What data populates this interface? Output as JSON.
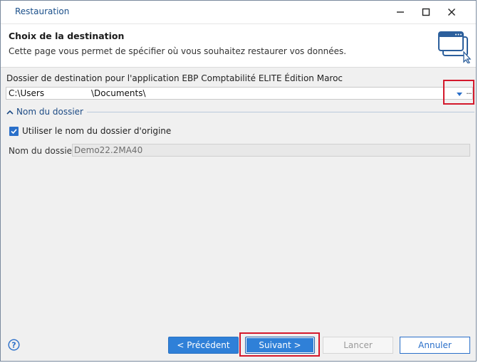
{
  "window": {
    "title": "Restauration"
  },
  "titlebar": {
    "min_symbol": "—",
    "max_symbol": "☐",
    "close_symbol": "✕"
  },
  "header": {
    "title": "Choix de la destination",
    "subtitle": "Cette page vous permet de spécifier où vous souhaitez restaurer vos données."
  },
  "destination": {
    "label": "Dossier de destination pour l'application EBP Comptabilité ELITE Édition Maroc",
    "path_start": "C:\\Users",
    "path_end": "\\Documents\\",
    "more_label": "···"
  },
  "folder_section": {
    "header": "Nom du dossier",
    "use_original_label": "Utiliser le nom du dossier d'origine",
    "use_original_checked": true,
    "name_label": "Nom du dossier",
    "name_value": "Demo22.2MA40"
  },
  "footer": {
    "previous_label": "< Précédent",
    "next_label": "Suivant >",
    "cancel_label": "Lancer",
    "annul_label": "Annuler"
  },
  "colors": {
    "accent": "#2f80d8",
    "highlight": "#d4192c",
    "section": "#1d4b85"
  }
}
